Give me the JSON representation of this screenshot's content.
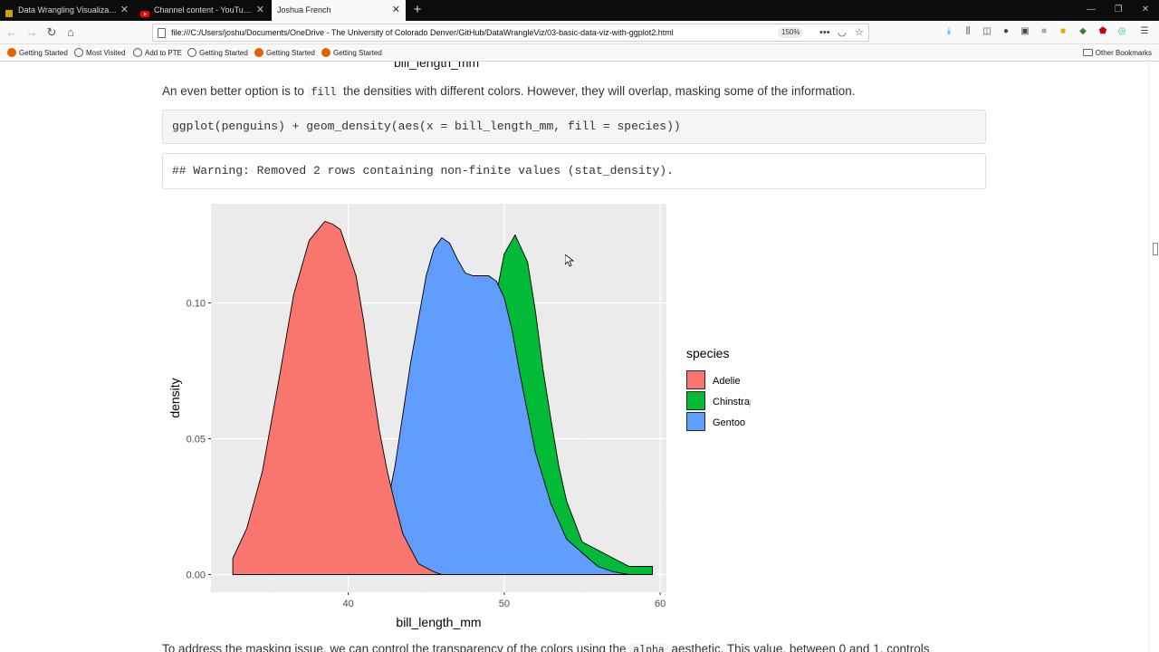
{
  "tabs": [
    {
      "label": "Data Wrangling Visualization l",
      "active": false,
      "icon_color": "#d0a000"
    },
    {
      "label": "Channel content - YouTube St",
      "active": false,
      "icon_color": "#ff0000"
    },
    {
      "label": "Joshua French",
      "active": true,
      "icon_color": ""
    }
  ],
  "nav": {
    "url": "file:///C:/Users/joshu/Documents/OneDrive - The University of Colorado Denver/GitHub/DataWrangleViz/03-basic-data-viz-with-ggplot2.html",
    "zoom": "150%"
  },
  "bookmarks": {
    "items": [
      "Getting Started",
      "Most Visited",
      "Add to PTE",
      "Getting Started",
      "Getting Started",
      "Getting Started"
    ],
    "other": "Other Bookmarks"
  },
  "page": {
    "partial_heading": "bill_length_mm",
    "para_before": "An even better option is to ",
    "para_code": "fill",
    "para_after": " the densities with different colors. However, they will overlap, masking some of the information.",
    "code": "ggplot(penguins) + geom_density(aes(x = bill_length_mm, fill = species))",
    "output": "## Warning: Removed 2 rows containing non-finite values (stat_density).",
    "bottom_pre": "To address the masking issue, we can control the transparency of the colors using the ",
    "bottom_code": "alpha",
    "bottom_post": " aesthetic. This value, between 0 and 1, controls"
  },
  "chart_data": {
    "type": "area",
    "xlabel": "bill_length_mm",
    "ylabel": "density",
    "xlim": [
      31.2,
      60.4
    ],
    "ylim": [
      -0.0065,
      0.1365
    ],
    "xticks": [
      40,
      50,
      60
    ],
    "yticks": [
      0.0,
      0.05,
      0.1
    ],
    "ytick_labels": [
      "0.00",
      "0.05",
      "0.10"
    ],
    "grid": true,
    "legend_title": "species",
    "legend_position": "right",
    "series": [
      {
        "name": "Adelie",
        "color": "#F8766D",
        "x": [
          32.6,
          33.5,
          34.5,
          35.5,
          36.5,
          37.5,
          38.5,
          39.0,
          39.5,
          40.5,
          41.0,
          41.5,
          42.0,
          42.5,
          43.0,
          43.5,
          44.5,
          45.5,
          46.0
        ],
        "y": [
          0.006,
          0.017,
          0.038,
          0.07,
          0.103,
          0.123,
          0.13,
          0.129,
          0.127,
          0.11,
          0.093,
          0.072,
          0.053,
          0.038,
          0.026,
          0.015,
          0.004,
          0.001,
          0.0
        ]
      },
      {
        "name": "Chinstrap",
        "color": "#00BA38",
        "x": [
          40.5,
          42.0,
          43.0,
          44.0,
          45.0,
          46.0,
          47.0,
          48.0,
          49.0,
          49.5,
          50.0,
          50.7,
          51.5,
          52.0,
          52.5,
          53.0,
          53.5,
          54.0,
          55.0,
          56.0,
          57.0,
          58.0,
          59.5
        ],
        "y": [
          0.0,
          0.002,
          0.006,
          0.012,
          0.022,
          0.036,
          0.05,
          0.068,
          0.088,
          0.103,
          0.118,
          0.125,
          0.115,
          0.097,
          0.075,
          0.057,
          0.04,
          0.027,
          0.012,
          0.009,
          0.006,
          0.003,
          0.003
        ]
      },
      {
        "name": "Gentoo",
        "color": "#619CFF",
        "x": [
          40.5,
          41.0,
          42.0,
          43.0,
          44.0,
          45.0,
          45.5,
          46.0,
          46.5,
          47.0,
          47.5,
          48.0,
          49.0,
          49.5,
          50.0,
          50.5,
          51.0,
          52.0,
          53.0,
          54.0,
          55.0,
          56.0,
          57.0,
          58.0,
          59.5
        ],
        "y": [
          0.0,
          0.001,
          0.011,
          0.04,
          0.078,
          0.11,
          0.12,
          0.124,
          0.122,
          0.116,
          0.111,
          0.11,
          0.11,
          0.108,
          0.102,
          0.09,
          0.074,
          0.045,
          0.026,
          0.013,
          0.008,
          0.003,
          0.001,
          0.0,
          0.0
        ]
      }
    ]
  }
}
